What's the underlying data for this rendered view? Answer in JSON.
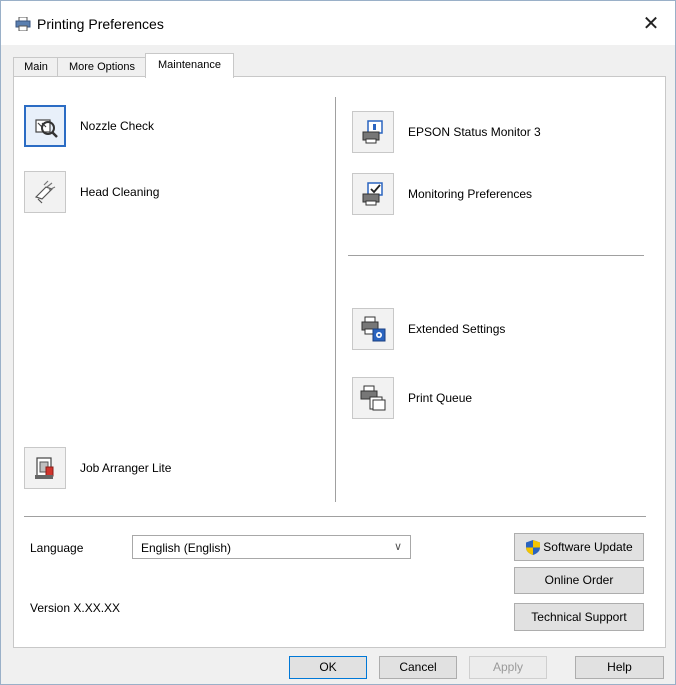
{
  "window": {
    "title": "Printing Preferences",
    "close_glyph": "✕"
  },
  "tabs": [
    {
      "label": "Main",
      "active": false
    },
    {
      "label": "More Options",
      "active": false
    },
    {
      "label": "Maintenance",
      "active": true
    }
  ],
  "left_items": [
    {
      "label": "Nozzle Check",
      "icon": "nozzle-check-icon"
    },
    {
      "label": "Head Cleaning",
      "icon": "head-cleaning-icon"
    },
    {
      "label": "Job Arranger Lite",
      "icon": "job-arranger-icon"
    }
  ],
  "right_items": [
    {
      "label": "EPSON Status Monitor 3",
      "icon": "status-monitor-icon"
    },
    {
      "label": "Monitoring Preferences",
      "icon": "monitoring-preferences-icon"
    },
    {
      "label": "Extended Settings",
      "icon": "extended-settings-icon"
    },
    {
      "label": "Print Queue",
      "icon": "print-queue-icon"
    }
  ],
  "language": {
    "label": "Language",
    "value": "English (English)",
    "chevron": "∨"
  },
  "version": "Version X.XX.XX",
  "buttons": {
    "software_update": "Software Update",
    "online_order": "Online Order",
    "technical_support": "Technical Support"
  },
  "footer": {
    "ok": "OK",
    "cancel": "Cancel",
    "apply": "Apply",
    "help": "Help"
  },
  "colors": {
    "accent": "#0078d7",
    "focus_border": "#2b6cc4",
    "shield_blue": "#2a64c0",
    "shield_yellow": "#f3c400"
  }
}
